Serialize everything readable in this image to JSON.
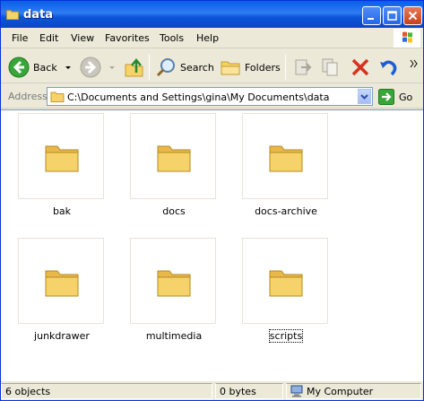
{
  "window": {
    "title": "data"
  },
  "menu": [
    "File",
    "Edit",
    "View",
    "Favorites",
    "Tools",
    "Help"
  ],
  "toolbar": {
    "back_label": "Back",
    "search_label": "Search",
    "folders_label": "Folders"
  },
  "address": {
    "label": "Address",
    "path": "C:\\Documents and Settings\\gina\\My Documents\\data",
    "go_label": "Go"
  },
  "folders": [
    {
      "name": "bak"
    },
    {
      "name": "docs"
    },
    {
      "name": "docs-archive"
    },
    {
      "name": "junkdrawer"
    },
    {
      "name": "multimedia"
    },
    {
      "name": "scripts"
    }
  ],
  "status": {
    "objects": "6 objects",
    "size": "0 bytes",
    "location": "My Computer"
  },
  "colors": {
    "titlebar": "#0a5fe8",
    "folder": "#f6d36a"
  },
  "icons": [
    "folder-icon",
    "back-icon",
    "forward-icon",
    "up-icon",
    "search-icon",
    "folders-icon",
    "move-to-icon",
    "copy-to-icon",
    "delete-icon",
    "undo-icon",
    "go-icon",
    "computer-icon",
    "windows-logo-icon",
    "minimize-icon",
    "maximize-icon",
    "close-icon"
  ]
}
